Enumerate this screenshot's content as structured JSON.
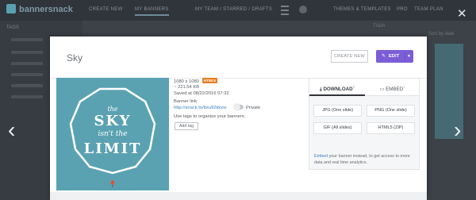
{
  "background": {
    "brand": "bannersnack",
    "nav": [
      "CREATE NEW",
      "MY BANNERS",
      "MY TEAM / STARRED / DRAFTS",
      "THEMES & TEMPLATES",
      "PRO",
      "TEAM PLAN"
    ],
    "sidebar_title": "TAGS",
    "right_text": [
      "Trash",
      "Sort by date"
    ]
  },
  "modal": {
    "title": "Sky",
    "create_new_label": "CREATE NEW",
    "edit_label": "EDIT",
    "preview": {
      "line1": "the",
      "line2": "SKY",
      "line3": "isn't the",
      "line4": "LIMIT"
    },
    "meta": {
      "dimensions": "1080 x 1080",
      "badge": "HTML5",
      "size": "~ 221.54 KB",
      "saved": "Saved at 08/22/2016 07:32",
      "banner_link_label": "Banner link:",
      "banner_link": "http://snack.to/bxu92kkzw",
      "private_label": "Private",
      "tags_hint": "Use tags to organize your banners.",
      "add_tag_label": "Add tag"
    },
    "panel": {
      "tab_download": "DOWNLOAD",
      "tab_embed": "EMBED",
      "buttons": [
        "JPG (One slide)",
        "PNG (One slide)",
        "GIF (All slides)",
        "HTML5 (ZIP)"
      ],
      "embed_link": "Embed",
      "embed_text": " your banner instead, to get access to more data and real time analytics."
    }
  },
  "colors": {
    "accent": "#7b5ed6",
    "link": "#3b7fc4",
    "badge": "#e67e22",
    "banner_bg": "#5aa2b2"
  },
  "icons": [
    "close-icon",
    "chevron-left-icon",
    "chevron-right-icon",
    "pencil-icon",
    "caret-down-icon",
    "download-icon",
    "embed-icon",
    "toggle-icon",
    "balloon-icon"
  ]
}
